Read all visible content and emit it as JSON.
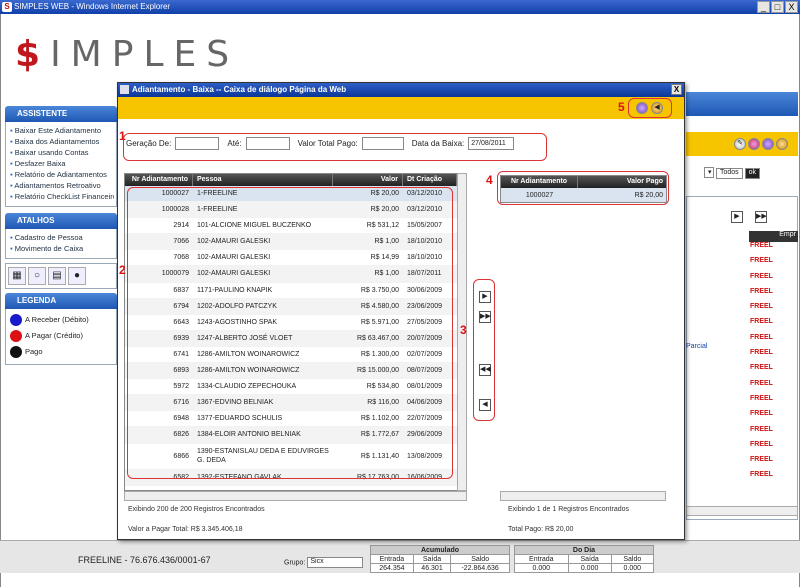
{
  "window": {
    "title": "SIMPLES WEB - Windows Internet Explorer",
    "controls": [
      "_",
      "□",
      "X"
    ]
  },
  "logo": {
    "text": "IMPLES",
    "symbol": "$"
  },
  "sidebar": {
    "assistente": {
      "title": "ASSISTENTE",
      "items": [
        "Baixar Este Adiantamento",
        "Baixa dos Adiantamentos",
        "Baixar usando Contas",
        "Desfazer Baixa",
        "Relatório de Adiantamentos",
        "Adiantamentos Retroativo",
        "Relatório CheckList Financeiro"
      ]
    },
    "atalhos": {
      "title": "ATALHOS",
      "items": [
        "Cadastro de Pessoa",
        "Movimento de Caixa"
      ]
    },
    "legenda": {
      "title": "LEGENDA",
      "items": [
        {
          "label": "A Receber (Débito)",
          "color": "#1a1acc"
        },
        {
          "label": "A Pagar (Crédito)",
          "color": "#dd1111"
        },
        {
          "label": "Pago",
          "color": "#111111"
        }
      ]
    }
  },
  "background": {
    "filter_select": "Todos",
    "rows_label": "FREEL",
    "col_label": "Empr",
    "parcial": "Parcial"
  },
  "status": {
    "company": "FREELINE - 76.676.436/0001-67",
    "grupo_label": "Grupo:",
    "grupo_value": "Sicx",
    "acumulado": {
      "title": "Acumulado",
      "h": [
        "Entrada",
        "Saída",
        "Saldo"
      ],
      "v": [
        "264.354",
        "46.301",
        "-22.864.636"
      ]
    },
    "dodia": {
      "title": "Do Dia",
      "h": [
        "Entrada",
        "Saída",
        "Saldo"
      ],
      "v": [
        "0.000",
        "0.000",
        "0.000"
      ]
    }
  },
  "dialog": {
    "title": "Adiantamento - Baixa -- Caixa de diálogo Página da Web",
    "close": "X",
    "filters": {
      "geracao_de": "Geração De:",
      "ate": "Até:",
      "valor_total_pago": "Valor Total Pago:",
      "data_baixa": "Data da Baixa:",
      "data_baixa_value": "27/08/2011"
    },
    "badges": [
      "1",
      "2",
      "3",
      "4",
      "5"
    ],
    "main_grid": {
      "headers": [
        "Nr Adiantamento",
        "Pessoa",
        "Valor",
        "Dt Criação"
      ],
      "rows": [
        [
          "1000027",
          "1-FREELINE",
          "R$ 20,00",
          "03/12/2010"
        ],
        [
          "1000028",
          "1-FREELINE",
          "R$ 20,00",
          "03/12/2010"
        ],
        [
          "2914",
          "101-ALCIONE MIGUEL BUCZENKO",
          "R$ 531,12",
          "15/05/2007"
        ],
        [
          "7066",
          "102-AMAURI GALESKI",
          "R$ 1,00",
          "18/10/2010"
        ],
        [
          "7068",
          "102-AMAURI GALESKI",
          "R$ 14,99",
          "18/10/2010"
        ],
        [
          "1000079",
          "102-AMAURI GALESKI",
          "R$ 1,00",
          "18/07/2011"
        ],
        [
          "6837",
          "1171-PAULINO KNAPIK",
          "R$ 3.750,00",
          "30/06/2009"
        ],
        [
          "6794",
          "1202-ADOLFO PATCZYK",
          "R$ 4.580,00",
          "23/06/2009"
        ],
        [
          "6643",
          "1243-AGOSTINHO SPAK",
          "R$ 5.971,00",
          "27/05/2009"
        ],
        [
          "6939",
          "1247-ALBERTO JOSÉ VLOET",
          "R$ 63.467,00",
          "20/07/2009"
        ],
        [
          "6741",
          "1286-AMILTON WOINAROWICZ",
          "R$ 1.300,00",
          "02/07/2009"
        ],
        [
          "6893",
          "1286-AMILTON WOINAROWICZ",
          "R$ 15.000,00",
          "08/07/2009"
        ],
        [
          "5972",
          "1334-CLAUDIO ZEPECHOUKA",
          "R$ 534,80",
          "08/01/2009"
        ],
        [
          "6716",
          "1367-EDVINO BELNIAK",
          "R$ 116,00",
          "04/06/2009"
        ],
        [
          "6948",
          "1377-EDUARDO SCHULIS",
          "R$ 1.102,00",
          "22/07/2009"
        ],
        [
          "6826",
          "1384-ELOIR ANTONIO BELNIAK",
          "R$ 1.772,67",
          "29/06/2009"
        ]
      ],
      "tall_row": [
        "6866",
        "1390-ESTANISLAU DEDA E EDUVIRGES G. DEDA",
        "R$ 1.131,40",
        "13/08/2009"
      ],
      "cut_row": [
        "6582",
        "1392-ESTEFANO GAVLAK",
        "R$ 17.763,00",
        "16/06/2009"
      ],
      "footer_count": "Exibindo 200 de 200 Registros Encontrados",
      "footer_total": "Valor a Pagar Total: R$ 3.345.406,18"
    },
    "move_buttons": [
      "▶",
      "▶▶",
      "◀◀",
      "◀"
    ],
    "right_grid": {
      "headers": [
        "Nr Adiantamento",
        "Valor Pago"
      ],
      "rows": [
        [
          "1000027",
          "R$ 20,00"
        ]
      ],
      "footer_count": "Exibindo 1 de 1 Registros Encontrados",
      "footer_total": "Total Pago: R$ 20,00"
    }
  }
}
